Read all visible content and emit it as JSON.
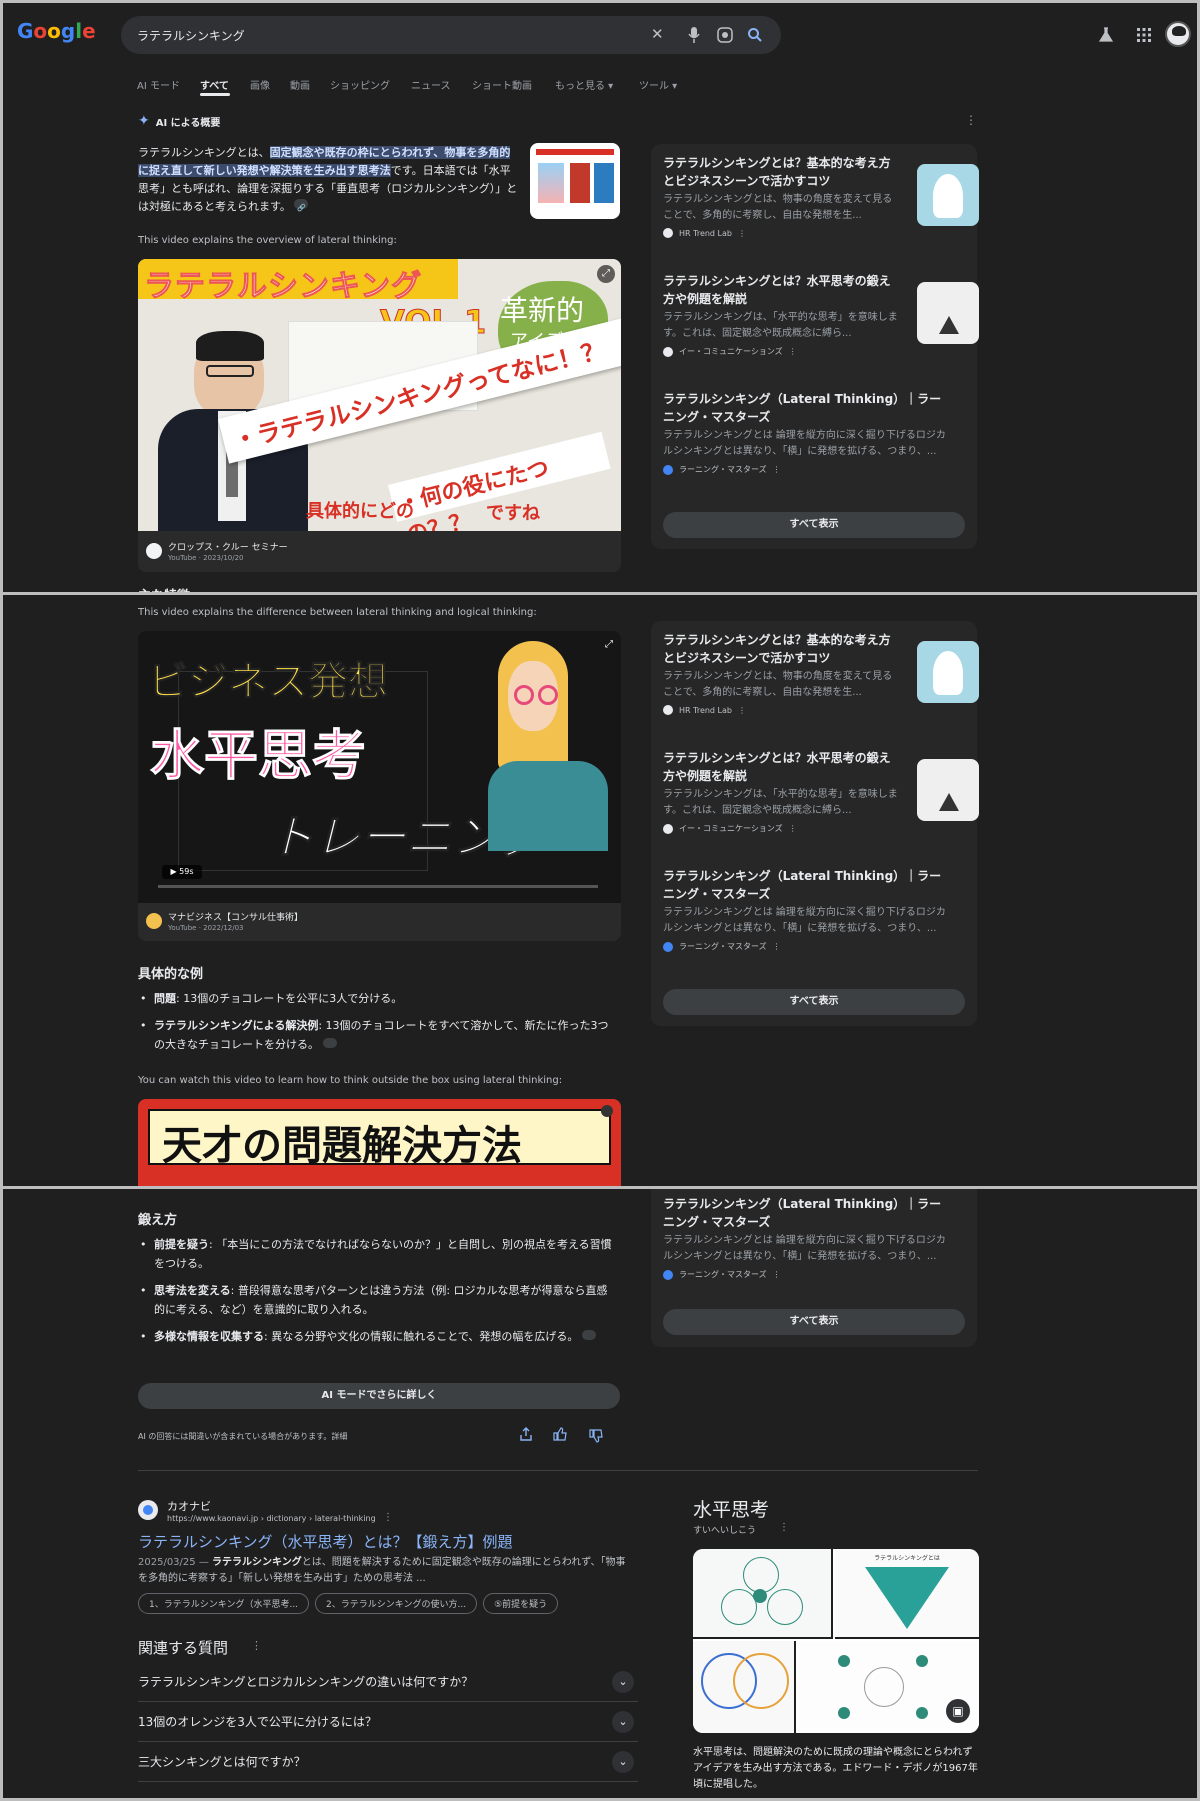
{
  "header": {
    "logo": "Google",
    "search_value": "ラテラルシンキング",
    "tabs": [
      "AI モード",
      "すべて",
      "画像",
      "動画",
      "ショッピング",
      "ニュース",
      "ショート動画",
      "もっと見る ▾",
      "ツール ▾"
    ],
    "active_tab": "すべて"
  },
  "ai": {
    "label": "AI による概要",
    "intro_pre": "ラテラルシンキングとは、",
    "intro_hl": "固定観念や既存の枠にとらわれず、物事を多角的に捉え直して新しい発想や解決策を生み出す思考法",
    "intro_post": "です。日本語では「水平思考」とも呼ばれ、論理を深掘りする「垂直思考（ロジカルシンキング）」とは対極にあると考えられます。",
    "video1_caption": "This video explains the overview of lateral thinking:",
    "video1": {
      "title_banner": "ラテラルシンキング",
      "vol": "VOL.1",
      "side1": "革新的",
      "side2": "アイディア",
      "line1": "・ラテラルシンキングってなに！？",
      "line2": "・何の役にたつの？？",
      "line3": "具体的にどの",
      "line4": "ですね",
      "channel": "クロップス・クルー セミナー",
      "meta": "YouTube · 2023/10/20"
    },
    "partial_heading": "主な特徴",
    "video2_caption": "This video explains the difference between lateral thinking and logical thinking:",
    "video2": {
      "line1": "ビジネス発想",
      "line2": "水平思考",
      "line3": "トレーニング",
      "duration": "▶ 59s",
      "channel": "マナビジネス【コンサル仕事術】",
      "meta": "YouTube · 2022/12/03"
    },
    "example_heading": "具体的な例",
    "example_items": [
      {
        "label": "問題",
        "text": ": 13個のチョコレートを公平に3人で分ける。"
      },
      {
        "label": "ラテラルシンキングによる解決例",
        "text": ": 13個のチョコレートをすべて溶かして、新たに作った3つの大きなチョコレートを分ける。"
      }
    ],
    "video3_caption": "You can watch this video to learn how to think outside the box using lateral thinking:",
    "video3_title": "天才の問題解決方法",
    "train_heading": "鍛え方",
    "train_items": [
      {
        "label": "前提を疑う",
        "text": ": 「本当にこの方法でなければならないのか？」と自問し、別の視点を考える習慣をつける。"
      },
      {
        "label": "思考法を変える",
        "text": ": 普段得意な思考パターンとは違う方法（例: ロジカルな思考が得意なら直感的に考える、など）を意識的に取り入れる。"
      },
      {
        "label": "多様な情報を収集する",
        "text": ": 異なる分野や文化の情報に触れることで、発想の幅を広げる。"
      }
    ],
    "ai_mode_button": "AI モードでさらに詳しく",
    "disclaimer": "AI の回答には間違いが含まれている場合があります。詳細"
  },
  "sources": [
    {
      "title": "ラテラルシンキングとは？基本的な考え方とビジネスシーンで活かすコツ",
      "snippet": "ラテラルシンキングとは、物事の角度を変えて見ることで、多角的に考察し、自由な発想を生...",
      "site": "HR Trend Lab"
    },
    {
      "title": "ラテラルシンキングとは？水平思考の鍛え方や例題を解説",
      "snippet": "ラテラルシンキングは、「水平的な思考」を意味します。これは、固定観念や既成概念に縛ら...",
      "site": "イー・コミュニケーションズ"
    },
    {
      "title": "ラテラルシンキング（Lateral Thinking）｜ラーニング・マスターズ",
      "snippet": "ラテラルシンキングとは 論理を縦方向に深く掘り下げるロジカルシンキングとは異なり、「横」に発想を拡げる、つまり、...",
      "site": "ラーニング・マスターズ"
    }
  ],
  "show_all": "すべて表示",
  "result": {
    "site_name": "カオナビ",
    "url": "https://www.kaonavi.jp › dictionary › lateral-thinking",
    "title": "ラテラルシンキング（水平思考）とは？【鍛え方】例題",
    "date": "2025/03/25 —",
    "snippet_bold": "ラテラルシンキング",
    "snippet": "とは、問題を解決するために固定観念や既存の論理にとらわれず、「物事を多角的に考察する」「新しい発想を生み出す」ための思考法 ...",
    "chips": [
      "1、ラテラルシンキング（水平思考...",
      "2、ラテラルシンキングの使い方...",
      "⑤前提を疑う"
    ]
  },
  "related": {
    "heading": "関連する質問",
    "questions": [
      "ラテラルシンキングとロジカルシンキングの違いは何ですか？",
      "13個のオレンジを3人で公平に分けるには？",
      "三大シンキングとは何ですか？"
    ]
  },
  "knowledge": {
    "title": "水平思考",
    "reading": "すいへいしこう",
    "diagram_label": "ラテラルシンキングとは",
    "description": "水平思考は、問題解決のために既成の理論や概念にとらわれずアイデアを生み出す方法である。エドワード・デボノが1967年頃に提唱した。"
  },
  "colors": {
    "accent": "#8ab4f8",
    "highlight": "#3c4a6b",
    "bg": "#1f1f1f"
  }
}
